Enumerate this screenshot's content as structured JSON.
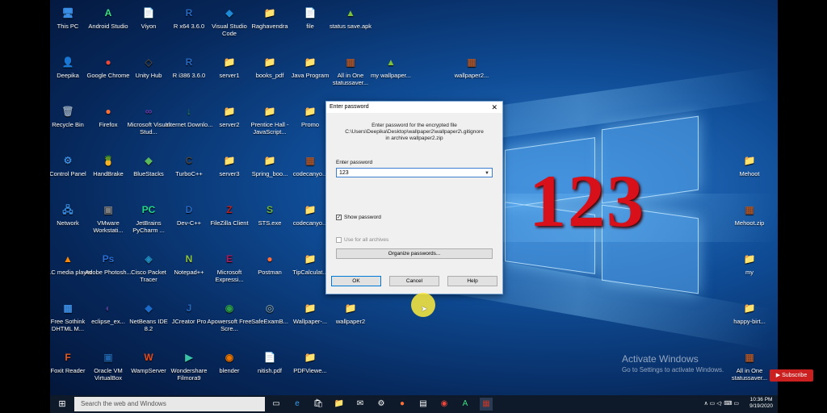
{
  "desktop": {
    "icons": [
      {
        "label": "This PC",
        "glyph": "🖥",
        "color": "#3a8ee6"
      },
      {
        "label": "Android Studio",
        "glyph": "A",
        "color": "#3ddc84"
      },
      {
        "label": "Viyon",
        "glyph": "📄",
        "color": "#ffffff"
      },
      {
        "label": "R x64 3.6.0",
        "glyph": "R",
        "color": "#2767bf"
      },
      {
        "label": "Visual Studio Code",
        "glyph": "◆",
        "color": "#1e8ad6"
      },
      {
        "label": "Raghavendra",
        "glyph": "📁",
        "color": "#e8c15a"
      },
      {
        "label": "file",
        "glyph": "📄",
        "color": "#ffffff"
      },
      {
        "label": "status save.apk",
        "glyph": "▲",
        "color": "#7cbf3a"
      },
      {
        "label": "Deepika",
        "glyph": "👤",
        "color": "#e8c15a"
      },
      {
        "label": "Google Chrome",
        "glyph": "●",
        "color": "#e8493c"
      },
      {
        "label": "Unity Hub",
        "glyph": "◇",
        "color": "#444444"
      },
      {
        "label": "R i386 3.6.0",
        "glyph": "R",
        "color": "#2767bf"
      },
      {
        "label": "server1",
        "glyph": "📁",
        "color": "#e8c15a"
      },
      {
        "label": "books_pdf",
        "glyph": "📁",
        "color": "#e8c15a"
      },
      {
        "label": "Java Program",
        "glyph": "📁",
        "color": "#e8c15a"
      },
      {
        "label": "All in One statussaver...",
        "glyph": "▦",
        "color": "#a0522d"
      },
      {
        "label": "my wallpaper...",
        "glyph": "▲",
        "color": "#7cbf3a"
      },
      {
        "label": "wallpaper2...",
        "glyph": "▦",
        "color": "#a0522d"
      },
      {
        "label": "Recycle Bin",
        "glyph": "🗑",
        "color": "#8aa0b8"
      },
      {
        "label": "Firefox",
        "glyph": "●",
        "color": "#ff7139"
      },
      {
        "label": "Microsoft Visual Stud...",
        "glyph": "∞",
        "color": "#6a3fb5"
      },
      {
        "label": "Internet Downlo...",
        "glyph": "↓",
        "color": "#2d9c4a"
      },
      {
        "label": "server2",
        "glyph": "📁",
        "color": "#e8c15a"
      },
      {
        "label": "Prentice Hall - JavaScript...",
        "glyph": "📁",
        "color": "#e8c15a"
      },
      {
        "label": "Promo",
        "glyph": "📁",
        "color": "#e8c15a"
      },
      {
        "label": "Control Panel",
        "glyph": "⚙",
        "color": "#3a8ee6"
      },
      {
        "label": "HandBrake",
        "glyph": "🍍",
        "color": "#c0392b"
      },
      {
        "label": "BlueStacks",
        "glyph": "◆",
        "color": "#5cb85c"
      },
      {
        "label": "TurboC++",
        "glyph": "C",
        "color": "#444444"
      },
      {
        "label": "server3",
        "glyph": "📁",
        "color": "#e8c15a"
      },
      {
        "label": "Spring_boo...",
        "glyph": "📁",
        "color": "#e8c15a"
      },
      {
        "label": "codecanyo...",
        "glyph": "▦",
        "color": "#a0522d"
      },
      {
        "label": "Network",
        "glyph": "🖧",
        "color": "#3a8ee6"
      },
      {
        "label": "VMware Workstati...",
        "glyph": "▣",
        "color": "#7d7d7d"
      },
      {
        "label": "JetBrains PyCharm ...",
        "glyph": "PC",
        "color": "#21d789"
      },
      {
        "label": "Dev-C++",
        "glyph": "D",
        "color": "#2767bf"
      },
      {
        "label": "FileZilla Client",
        "glyph": "Z",
        "color": "#bf1e1e"
      },
      {
        "label": "STS.exe",
        "glyph": "S",
        "color": "#6db33f"
      },
      {
        "label": "codecanyo...",
        "glyph": "📁",
        "color": "#e8c15a"
      },
      {
        "label": "VLC media player",
        "glyph": "▲",
        "color": "#ff8800"
      },
      {
        "label": "Adobe Photosh...",
        "glyph": "Ps",
        "color": "#2a6fd6"
      },
      {
        "label": "Cisco Packet Tracer",
        "glyph": "◈",
        "color": "#1f8ac0"
      },
      {
        "label": "Notepad++",
        "glyph": "N",
        "color": "#90c53f"
      },
      {
        "label": "Microsoft Expressi...",
        "glyph": "E",
        "color": "#b0185c"
      },
      {
        "label": "Postman",
        "glyph": "●",
        "color": "#ff6c37"
      },
      {
        "label": "TipCalculat...",
        "glyph": "📁",
        "color": "#e8c15a"
      },
      {
        "label": "Free Sothink DHTML M...",
        "glyph": "▦",
        "color": "#3a8ee6"
      },
      {
        "label": "eclipse_ex...",
        "glyph": "◐",
        "color": "#4a3d8f"
      },
      {
        "label": "NetBeans IDE 8.2",
        "glyph": "◆",
        "color": "#1b6ac9"
      },
      {
        "label": "JCreator Pro",
        "glyph": "J",
        "color": "#2767bf"
      },
      {
        "label": "Apowersoft Free Scre...",
        "glyph": "◉",
        "color": "#2d9c4a"
      },
      {
        "label": "SafeExamB...",
        "glyph": "◎",
        "color": "#6d8fa6"
      },
      {
        "label": "Wallpaper-...",
        "glyph": "📁",
        "color": "#e8c15a"
      },
      {
        "label": "wallpaper2",
        "glyph": "📁",
        "color": "#e8c15a"
      },
      {
        "label": "Foxit Reader",
        "glyph": "F",
        "color": "#e8581c"
      },
      {
        "label": "Oracle VM VirtualBox",
        "glyph": "▣",
        "color": "#1c5fa6"
      },
      {
        "label": "WampServer",
        "glyph": "W",
        "color": "#e64a19"
      },
      {
        "label": "Wondershare Filmora9",
        "glyph": "▶",
        "color": "#3ac2a8"
      },
      {
        "label": "blender",
        "glyph": "◉",
        "color": "#ea7600"
      },
      {
        "label": "nitish.pdf",
        "glyph": "📄",
        "color": "#ffffff"
      },
      {
        "label": "PDFViewe...",
        "glyph": "📁",
        "color": "#e8c15a"
      },
      {
        "label": "Mehoot",
        "glyph": "📁",
        "color": "#e8c15a"
      },
      {
        "label": "Mehoot.zip",
        "glyph": "▦",
        "color": "#a0522d"
      },
      {
        "label": "my",
        "glyph": "📁",
        "color": "#e8c15a"
      },
      {
        "label": "happy-birt...",
        "glyph": "📁",
        "color": "#e8c15a"
      },
      {
        "label": "All in One statussaver...",
        "glyph": "▦",
        "color": "#a0522d"
      }
    ]
  },
  "overlay_text": "123",
  "dialog": {
    "title": "Enter password",
    "close": "✕",
    "message_line1": "Enter password for the encrypted file",
    "message_line2": "C:\\Users\\Deepika\\Desktop\\wallpaper2\\wallpaper2\\.gitignore",
    "message_line3": "in archive wallpaper2.zip",
    "password_label": "Enter password",
    "password_value": "123",
    "show_password_label": "Show password",
    "use_all_label": "Use for all archives",
    "organize_button": "Organize passwords...",
    "ok_button": "OK",
    "cancel_button": "Cancel",
    "help_button": "Help"
  },
  "activation": {
    "title": "Activate Windows",
    "subtitle": "Go to Settings to activate Windows."
  },
  "taskbar": {
    "search_placeholder": "Search the web and Windows",
    "time": "10:36 PM",
    "date": "9/19/2020",
    "tray": "∧ ▭ ◁ᐧ ⌨ ▭"
  },
  "subscribe": "▶ Subscribe"
}
